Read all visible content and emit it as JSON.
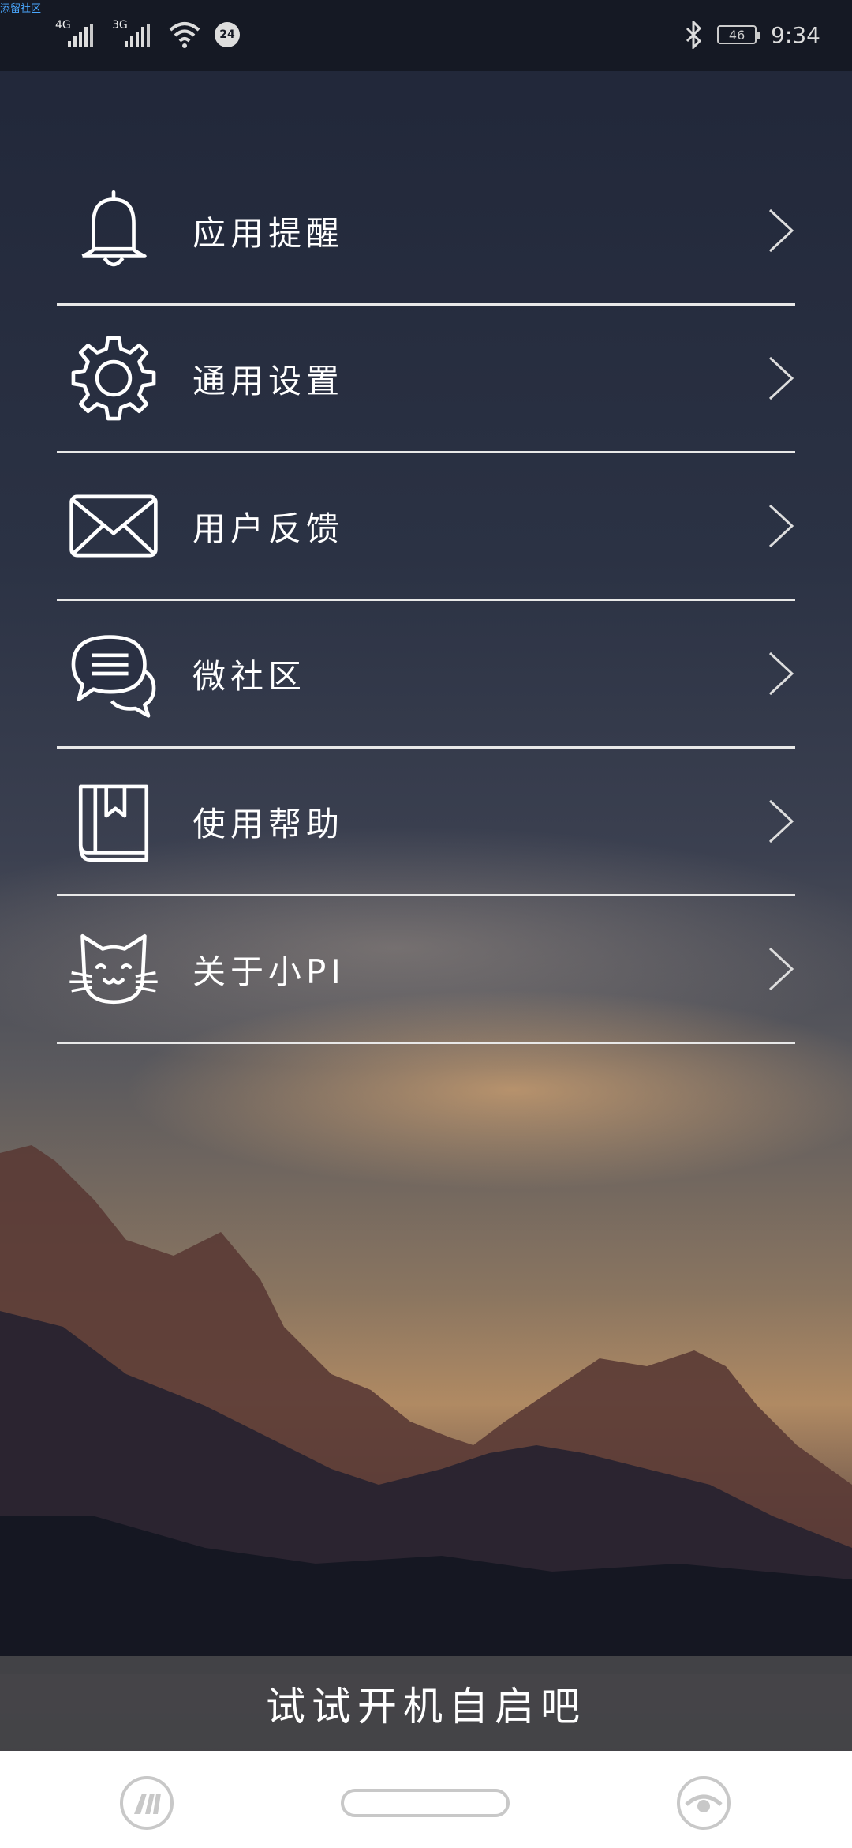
{
  "watermark": "添留社区",
  "status_bar": {
    "signal1": "4G",
    "signal2": "3G",
    "badge": "24",
    "battery": "46",
    "time": "9:34"
  },
  "menu": {
    "items": [
      {
        "label": "应用提醒",
        "icon": "bell-icon"
      },
      {
        "label": "通用设置",
        "icon": "gear-icon"
      },
      {
        "label": "用户反馈",
        "icon": "envelope-icon"
      },
      {
        "label": "微社区",
        "icon": "chat-bubbles-icon"
      },
      {
        "label": "使用帮助",
        "icon": "book-icon"
      },
      {
        "label": "关于小PI",
        "icon": "cat-icon"
      }
    ]
  },
  "bottom_bar": {
    "label": "试试开机自启吧"
  },
  "colors": {
    "status_bar_bg": "#151924",
    "divider": "#e8e8e8",
    "bottom_bar_bg": "#46464a",
    "nav_bar_bg": "#ffffff"
  }
}
